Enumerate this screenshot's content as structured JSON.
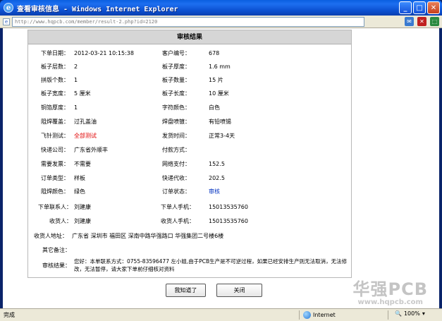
{
  "window": {
    "title": "查看审核信息 - Windows Internet Explorer",
    "icon": "ie-icon",
    "controls": [
      "minimize",
      "maximize",
      "close"
    ]
  },
  "address": {
    "url": "http://www.hqpcb.com/member/result-2.php?id=2120"
  },
  "panel": {
    "heading": "审核结果"
  },
  "fields": {
    "order_date_label": "下单日期：",
    "order_date": "2012-03-21 10:15:38",
    "customer_no_label": "客户编号：",
    "customer_no": "678",
    "layers_label": "板子层数：",
    "layers": "2",
    "thickness_label": "板子厚度：",
    "thickness": "1.6 mm",
    "panel_count_label": "拼版个数：",
    "panel_count": "1",
    "quantity_label": "板子数量：",
    "quantity": "15 片",
    "width_label": "板子宽度：",
    "width": "5 厘米",
    "length_label": "板子长度：",
    "length": "10 厘米",
    "copper_label": "铜箔厚度：",
    "copper": "1",
    "silk_label": "字符颜色：",
    "silk": "白色",
    "mask_cover_label": "阻焊覆盖：",
    "mask_cover": "过孔盖油",
    "finish_label": "焊盘喷镀：",
    "finish": "有铅喷锡",
    "flying_label": "飞针测试：",
    "flying": "全部测试",
    "ship_time_label": "发货时间：",
    "ship_time": "正常3-4天",
    "courier_label": "快递公司：",
    "courier": "广东省外顺丰",
    "payment_label": "付款方式：",
    "payment": "",
    "invoice_label": "需要发票：",
    "invoice": "不需要",
    "online_pay_label": "网络支付：",
    "online_pay": "152.5",
    "order_type_label": "订单类型：",
    "order_type": "样板",
    "cod_label": "快递代收：",
    "cod": "202.5",
    "mask_color_label": "阻焊颜色：",
    "mask_color": "绿色",
    "status_label": "订单状态：",
    "status": "审核",
    "contact_label": "下单联系人：",
    "contact": "刘建康",
    "contact_phone_label": "下单人手机：",
    "contact_phone": "15013535760",
    "receiver_label": "收货人：",
    "receiver": "刘建康",
    "receiver_phone_label": "收货人手机：",
    "receiver_phone": "15013535760",
    "address_label": "收货人地址：",
    "address": "广东省 深圳市 福田区 深南中路华强路口 华强集团二号楼6楼",
    "notes_label": "其它备注：",
    "notes": "",
    "result_label": "审核结果：",
    "result": "您好：本单联系方式：0755-83596477 左小姐,由于PCB生产是不可逆过程，如果已经安排生产则无法取消，无法修改，无法暂停，请大家下单前仔细核对资料"
  },
  "buttons": {
    "ok": "我知道了",
    "close": "关闭"
  },
  "watermark": {
    "brand": "华强PCB",
    "url": "www.hqpcb.com"
  },
  "status_bar": {
    "status": "完成",
    "zone": "Internet",
    "zoom": "100%"
  },
  "colors": {
    "titlebar": "#0b4fd0",
    "accent_red": "#e00000",
    "accent_blue": "#0030c0",
    "panel_header": "#d6d6d6"
  }
}
